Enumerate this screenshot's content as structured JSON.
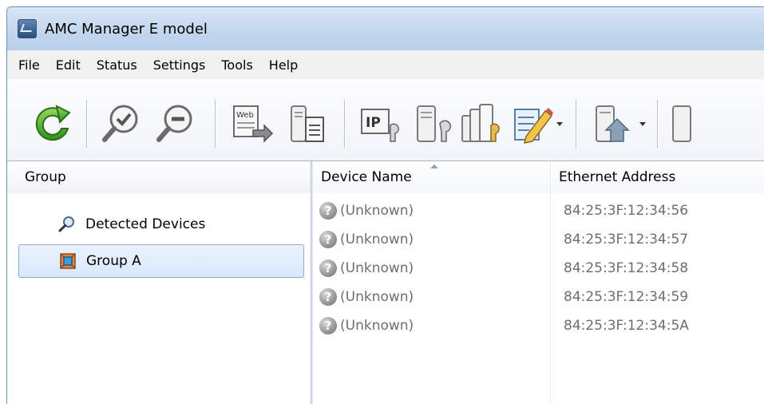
{
  "window": {
    "title": "AMC Manager E model"
  },
  "menu": [
    {
      "label": "File"
    },
    {
      "label": "Edit"
    },
    {
      "label": "Status"
    },
    {
      "label": "Settings"
    },
    {
      "label": "Tools"
    },
    {
      "label": "Help"
    }
  ],
  "toolbar": {
    "buttons": [
      {
        "icon": "refresh-icon"
      },
      {
        "icon": "search-check-icon"
      },
      {
        "icon": "search-minus-icon"
      },
      {
        "icon": "web-icon",
        "text": "Web"
      },
      {
        "icon": "device-document-icon"
      },
      {
        "icon": "ip-settings-icon",
        "text": "IP"
      },
      {
        "icon": "device-settings-icon"
      },
      {
        "icon": "multi-device-settings-icon"
      },
      {
        "icon": "edit-pencil-icon"
      },
      {
        "icon": "device-upload-icon"
      }
    ]
  },
  "group_panel": {
    "header": "Group",
    "items": [
      {
        "label": "Detected Devices",
        "icon": "search-icon",
        "selected": false
      },
      {
        "label": "Group A",
        "icon": "group-icon",
        "selected": true
      }
    ]
  },
  "device_list": {
    "columns": [
      {
        "label": "Device Name"
      },
      {
        "label": "Ethernet Address"
      }
    ],
    "rows": [
      {
        "name": "(Unknown)",
        "ethernet": "84:25:3F:12:34:56"
      },
      {
        "name": "(Unknown)",
        "ethernet": "84:25:3F:12:34:57"
      },
      {
        "name": "(Unknown)",
        "ethernet": "84:25:3F:12:34:58"
      },
      {
        "name": "(Unknown)",
        "ethernet": "84:25:3F:12:34:59"
      },
      {
        "name": "(Unknown)",
        "ethernet": "84:25:3F:12:34:5A"
      }
    ]
  },
  "colors": {
    "titlebar": "#c3d7ee",
    "selection": "#d8e8fb",
    "unknown_text": "#6e6e6e"
  }
}
